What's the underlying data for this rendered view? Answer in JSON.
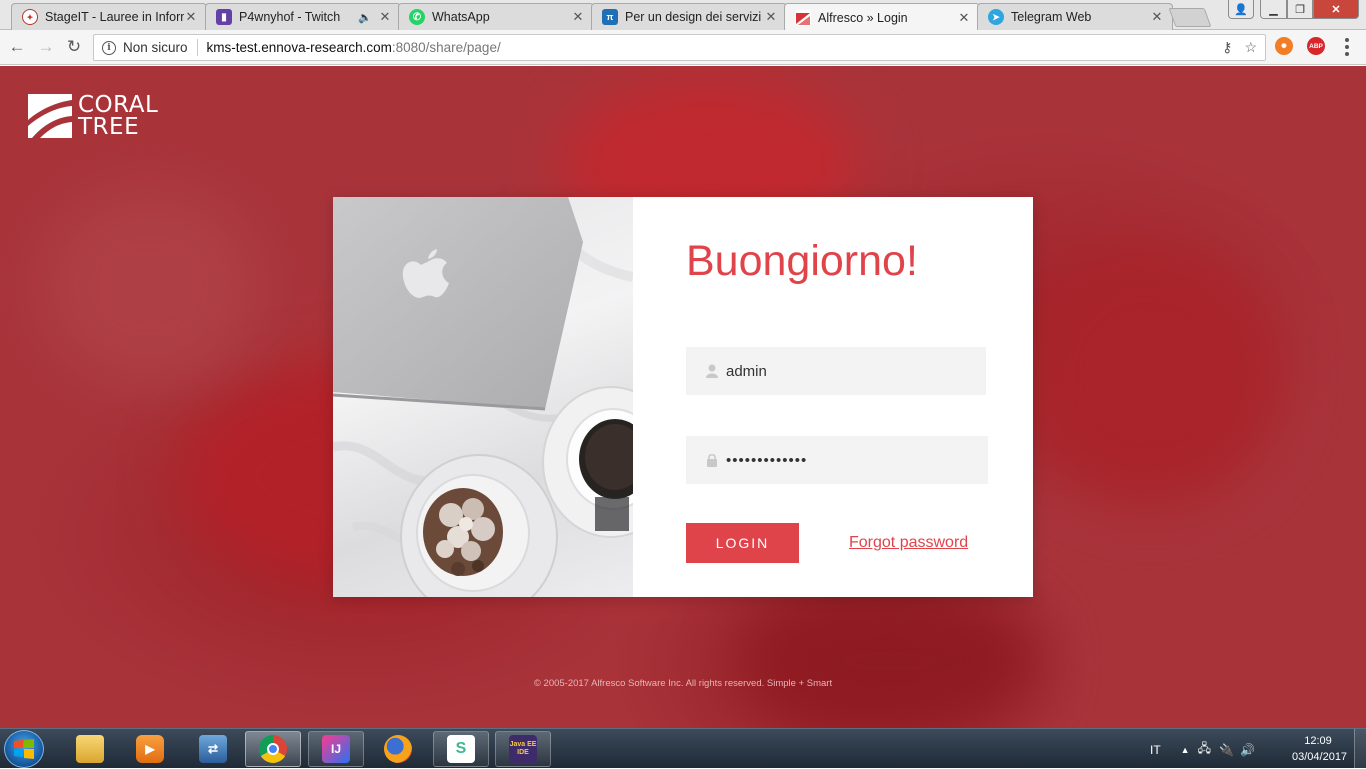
{
  "browser": {
    "tabs": [
      {
        "title": "StageIT - Lauree in Informatica",
        "favicon": "unipd-seal-icon",
        "color": "#b03a2e"
      },
      {
        "title": "P4wnyhof - Twitch",
        "favicon": "twitch-icon",
        "color": "#6441a4",
        "audio": true
      },
      {
        "title": "WhatsApp",
        "favicon": "whatsapp-icon",
        "color": "#25d366"
      },
      {
        "title": "Per un design dei servizi",
        "favicon": "medium-icon",
        "color": "#1f6fb5"
      },
      {
        "title": "Alfresco » Login",
        "favicon": "alfresco-icon",
        "color": "#d7343a",
        "active": true
      },
      {
        "title": "Telegram Web",
        "favicon": "telegram-icon",
        "color": "#2ea6de"
      }
    ],
    "address": {
      "security_label": "Non sicuro",
      "host": "kms-test.ennova-research.com",
      "path": ":8080/share/page/"
    },
    "extensions": [
      {
        "name": "hola-extension-icon",
        "color": "#f27d24"
      },
      {
        "name": "adblock-plus-icon",
        "color": "#d8262b",
        "label": "ABP"
      }
    ]
  },
  "page": {
    "logo": {
      "line1": "CORAL",
      "line2": "TREE"
    },
    "greeting": "Buongiorno!",
    "username": {
      "value": "admin"
    },
    "password": {
      "value": "•••••••••••••"
    },
    "login_label": "LOGIN",
    "forgot_label": "Forgot password",
    "footer": "© 2005-2017 Alfresco Software Inc. All rights reserved. Simple + Smart",
    "accent_color": "#e0444b"
  },
  "taskbar": {
    "items": [
      {
        "name": "file-explorer-icon"
      },
      {
        "name": "media-player-icon"
      },
      {
        "name": "network-tool-icon"
      },
      {
        "name": "chrome-icon",
        "active": true
      },
      {
        "name": "intellij-icon",
        "label": "IJ"
      },
      {
        "name": "firefox-icon"
      },
      {
        "name": "slack-icon",
        "label": "S"
      },
      {
        "name": "eclipse-javaee-icon",
        "label": "Java EE IDE"
      }
    ],
    "language": "IT",
    "time": "12:09",
    "date": "03/04/2017"
  }
}
